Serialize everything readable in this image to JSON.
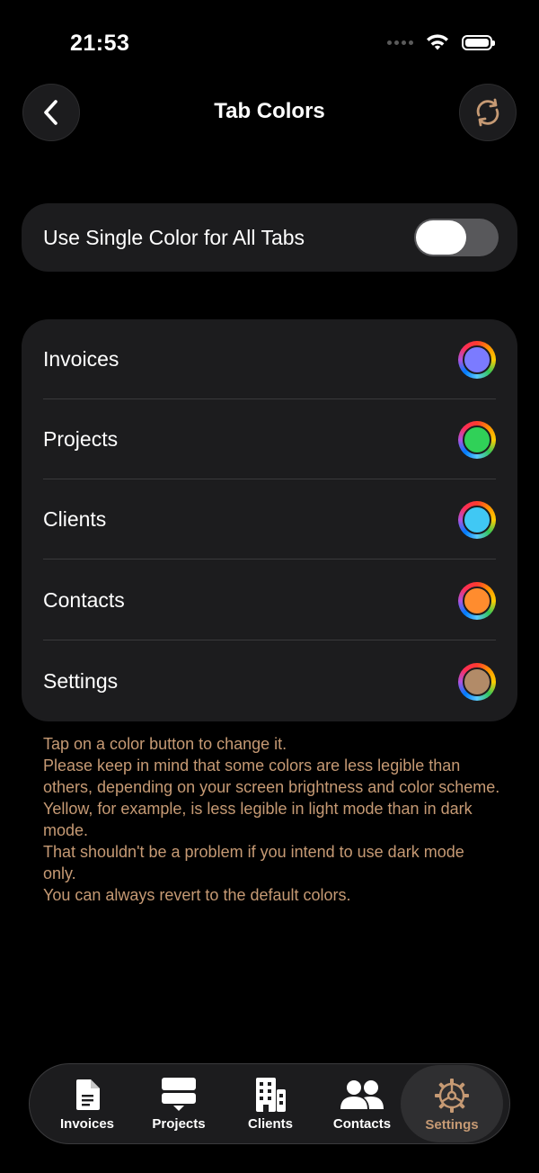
{
  "status_bar": {
    "time": "21:53"
  },
  "header": {
    "title": "Tab Colors",
    "back_icon": "chevron-left-icon",
    "refresh_icon": "refresh-icon"
  },
  "single_color": {
    "label": "Use Single Color for All Tabs",
    "enabled": false
  },
  "tab_colors": [
    {
      "label": "Invoices",
      "color": "#7b7bff"
    },
    {
      "label": "Projects",
      "color": "#30d158"
    },
    {
      "label": "Clients",
      "color": "#40c8f4"
    },
    {
      "label": "Contacts",
      "color": "#ff8c2e"
    },
    {
      "label": "Settings",
      "color": "#b28b68"
    }
  ],
  "footer_note": {
    "line1": "Tap on a color button to change it.",
    "line2": "Please keep in mind that some colors are less legible than others, depending on your screen brightness and color scheme.",
    "line3": "Yellow, for example, is less legible in light mode than in dark mode.",
    "line4": "That shouldn't be a problem if you intend to use dark mode only.",
    "line5": "You can always revert to the default colors."
  },
  "tab_bar": {
    "items": [
      {
        "label": "Invoices",
        "icon": "document-icon"
      },
      {
        "label": "Projects",
        "icon": "stack-icon"
      },
      {
        "label": "Clients",
        "icon": "building-icon"
      },
      {
        "label": "Contacts",
        "icon": "people-icon"
      },
      {
        "label": "Settings",
        "icon": "gear-icon"
      }
    ],
    "active": "Settings"
  },
  "colors": {
    "accent": "#c69a74",
    "card": "#1c1c1e",
    "background": "#000000"
  }
}
